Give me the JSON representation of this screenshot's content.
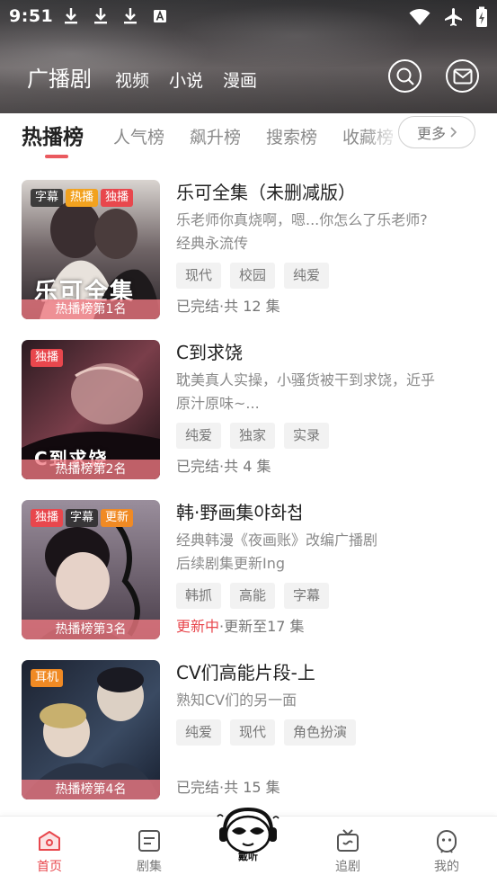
{
  "status_bar": {
    "time": "9:51",
    "download_count": 3
  },
  "header": {
    "tabs": [
      {
        "label": "广播剧",
        "active": true
      },
      {
        "label": "视频"
      },
      {
        "label": "小说"
      },
      {
        "label": "漫画"
      }
    ],
    "search_icon": "search-icon",
    "mail_icon": "mail-icon"
  },
  "rank_tabs": {
    "items": [
      "热播榜",
      "人气榜",
      "飙升榜",
      "搜索榜",
      "收藏榜"
    ],
    "active_index": 0,
    "more_label": "更多"
  },
  "items": [
    {
      "title": "乐可全集（未删减版）",
      "desc_lines": [
        "乐老师你真烧啊，嗯...你怎么了乐老师?",
        "经典永流传"
      ],
      "tags": [
        "现代",
        "校园",
        "纯爱"
      ],
      "status": "已完结",
      "status_suffix": "·共 12 集",
      "badges": [
        {
          "text": "字幕",
          "style": "dark"
        },
        {
          "text": "热播",
          "style": "yellow"
        },
        {
          "text": "独播",
          "style": "red"
        }
      ],
      "rank_caption": "热播榜第1名",
      "cover_text": "乐可全集",
      "accent": "#3a3038"
    },
    {
      "title": "C到求饶",
      "desc_lines": [
        "耽美真人实操，小骚货被干到求饶，近乎",
        "原汁原味~..."
      ],
      "tags": [
        "纯爱",
        "独家",
        "实录"
      ],
      "status": "已完结",
      "status_suffix": "·共 4 集",
      "badges": [
        {
          "text": "独播",
          "style": "red"
        }
      ],
      "rank_caption": "热播榜第2名",
      "cover_text": "C到求饶",
      "accent": "#5a2a34"
    },
    {
      "title": "韩·野画集야화첩",
      "desc_lines": [
        "经典韩漫《夜画账》改编广播剧",
        "后续剧集更新Ing"
      ],
      "tags": [
        "韩抓",
        "高能",
        "字幕"
      ],
      "status": "更新中",
      "status_suffix": "·更新至17 集",
      "status_hot": true,
      "badges": [
        {
          "text": "独播",
          "style": "red"
        },
        {
          "text": "字幕",
          "style": "dark"
        },
        {
          "text": "更新",
          "style": "orange"
        }
      ],
      "rank_caption": "热播榜第3名",
      "cover_text": "",
      "accent": "#6a5a68"
    },
    {
      "title": "CV们高能片段-上",
      "desc_lines": [
        "熟知CV们的另一面"
      ],
      "tags": [
        "纯爱",
        "现代",
        "角色扮演"
      ],
      "status": "已完结",
      "status_suffix": "·共 15 集",
      "badges": [
        {
          "text": "耳机",
          "style": "orange"
        }
      ],
      "rank_caption": "热播榜第4名",
      "cover_text": "",
      "accent": "#2f3a4a"
    }
  ],
  "bottom_nav": [
    {
      "label": "首页",
      "icon": "home-icon",
      "active": true
    },
    {
      "label": "剧集",
      "icon": "episodes-icon"
    },
    {
      "label": "追剧",
      "icon": "tv-icon"
    },
    {
      "label": "我的",
      "icon": "profile-icon"
    }
  ],
  "mascot_text": "戴听",
  "colors": {
    "accent": "#e8474d",
    "underline": "#ea5a5f"
  }
}
